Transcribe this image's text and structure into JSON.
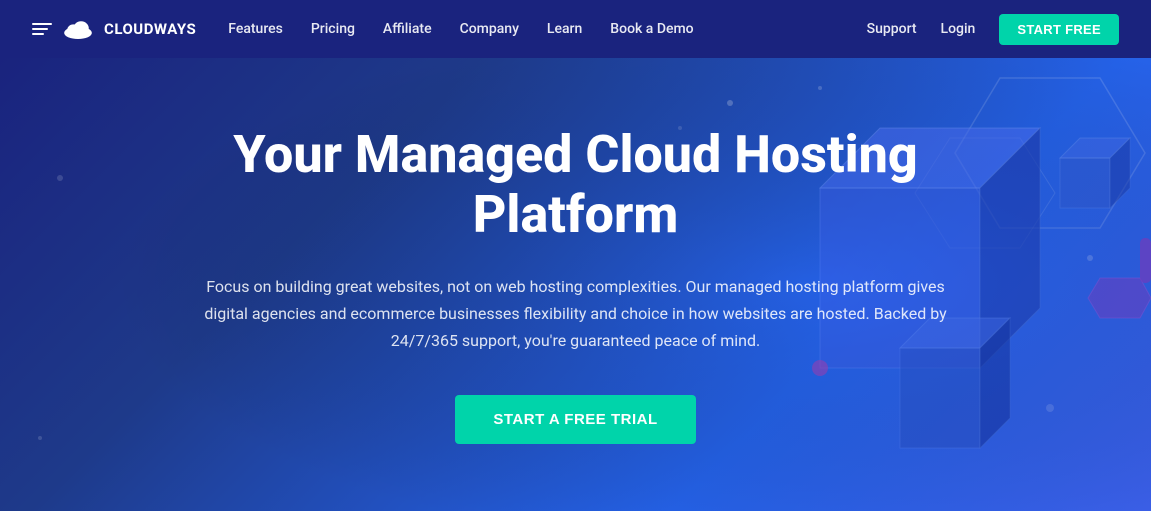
{
  "navbar": {
    "logo_text": "CLOUDWAYS",
    "nav_links": [
      {
        "label": "Features",
        "id": "features"
      },
      {
        "label": "Pricing",
        "id": "pricing"
      },
      {
        "label": "Affiliate",
        "id": "affiliate"
      },
      {
        "label": "Company",
        "id": "company"
      },
      {
        "label": "Learn",
        "id": "learn"
      },
      {
        "label": "Book a Demo",
        "id": "book-demo"
      }
    ],
    "right_links": [
      {
        "label": "Support",
        "id": "support"
      },
      {
        "label": "Login",
        "id": "login"
      }
    ],
    "start_free_label": "START FREE"
  },
  "hero": {
    "title": "Your Managed Cloud Hosting Platform",
    "subtitle": "Focus on building great websites, not on web hosting complexities. Our managed hosting platform gives digital agencies and ecommerce businesses flexibility and choice in how websites are hosted. Backed by 24/7/365 support, you're guaranteed peace of mind.",
    "cta_label": "START A FREE TRIAL"
  },
  "colors": {
    "accent": "#00d4aa",
    "bg_dark": "#1a237e",
    "bg_mid": "#2563eb"
  }
}
